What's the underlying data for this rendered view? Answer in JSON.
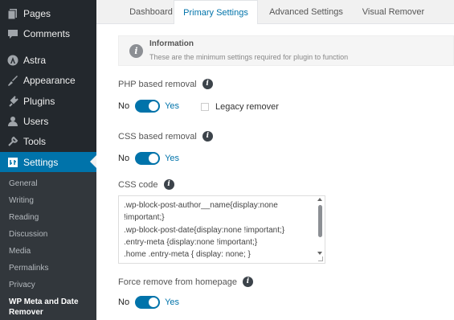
{
  "sidebar": {
    "items": [
      {
        "label": "Pages",
        "icon": "pages-icon"
      },
      {
        "label": "Comments",
        "icon": "comments-icon"
      },
      {
        "label": "Astra",
        "icon": "astra-icon"
      },
      {
        "label": "Appearance",
        "icon": "appearance-icon"
      },
      {
        "label": "Plugins",
        "icon": "plugins-icon"
      },
      {
        "label": "Users",
        "icon": "users-icon"
      },
      {
        "label": "Tools",
        "icon": "tools-icon"
      },
      {
        "label": "Settings",
        "icon": "settings-icon"
      }
    ],
    "submenu": [
      "General",
      "Writing",
      "Reading",
      "Discussion",
      "Media",
      "Permalinks",
      "Privacy"
    ],
    "submenu_current": [
      "WP Meta and Date",
      "Remover"
    ]
  },
  "tabs": [
    {
      "label": "Dashboard"
    },
    {
      "label": "Primary Settings"
    },
    {
      "label": "Advanced Settings"
    },
    {
      "label": "Visual Remover"
    }
  ],
  "info": {
    "title": "Information",
    "description": "These are the minimum settings required for plugin to function"
  },
  "settings": {
    "php_label": "PHP based removal",
    "css_label": "CSS based removal",
    "css_code_label": "CSS code",
    "force_label": "Force remove from homepage",
    "no_label": "No",
    "yes_label": "Yes",
    "legacy_label": "Legacy remover",
    "help_glyph": "i",
    "php_enabled": true,
    "css_enabled": true,
    "force_enabled": true,
    "legacy_checked": false
  },
  "css_code": [
    ".wp-block-post-author__name{display:none",
    "!important;}",
    ".wp-block-post-date{display:none !important;}",
    " .entry-meta {display:none !important;}",
    "    .home .entry-meta { display: none; }"
  ],
  "colors": {
    "accent": "#0073aa",
    "sidebar_bg": "#23282d",
    "submenu_bg": "#32373c"
  }
}
